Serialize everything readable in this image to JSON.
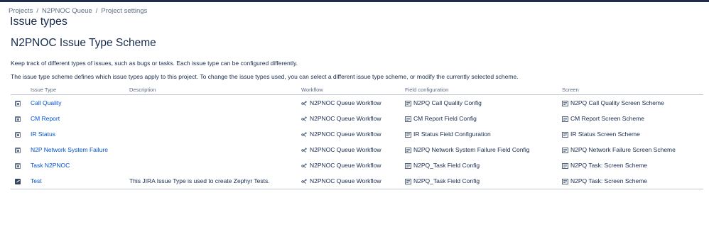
{
  "breadcrumb": [
    "Projects",
    "N2PNOC Queue",
    "Project settings"
  ],
  "page_title": "Issue types",
  "scheme_title": "N2PNOC Issue Type Scheme",
  "description_1": "Keep track of different types of issues, such as bugs or tasks. Each issue type can be configured differently.",
  "description_2": "The issue type scheme defines which issue types apply to this project. To change the issue types used, you can select a different issue type scheme, or modify the currently selected scheme.",
  "columns": {
    "issue_type": "Issue Type",
    "description": "Description",
    "workflow": "Workflow",
    "field_configuration": "Field configuration",
    "screen": "Screen"
  },
  "rows": [
    {
      "icon": "issue-type-icon",
      "name": "Call Quality",
      "description": "",
      "workflow": "N2PNOC Queue Workflow",
      "field_config": "N2PQ Call Quality Config",
      "screen": "N2PQ Call Quality Screen Scheme"
    },
    {
      "icon": "issue-type-icon",
      "name": "CM Report",
      "description": "",
      "workflow": "N2PNOC Queue Workflow",
      "field_config": "CM Report Field Config",
      "screen": "CM Report Screen Scheme"
    },
    {
      "icon": "issue-type-icon",
      "name": "IR Status",
      "description": "",
      "workflow": "N2PNOC Queue Workflow",
      "field_config": "IR Status Field Configuration",
      "screen": "IR Status Screen Scheme"
    },
    {
      "icon": "issue-type-icon",
      "name": "N2P Network System Failure",
      "description": "",
      "workflow": "N2PNOC Queue Workflow",
      "field_config": "N2PQ Network System Failure Field Config",
      "screen": "N2PQ Network Failure Screen Scheme"
    },
    {
      "icon": "issue-type-icon",
      "name": "Task N2PNOC",
      "description": "",
      "workflow": "N2PNOC Queue Workflow",
      "field_config": "N2PQ_Task Field Config",
      "screen": "N2PQ Task: Screen Scheme"
    },
    {
      "icon": "test-issue-icon",
      "name": "Test",
      "description": "This JIRA Issue Type is used to create Zephyr Tests.",
      "workflow": "N2PNOC Queue Workflow",
      "field_config": "N2PQ_Task Field Config",
      "screen": "N2PQ Task: Screen Scheme"
    }
  ],
  "colors": {
    "link": "#0052cc",
    "text": "#172b4d",
    "muted": "#5e6c84",
    "topbar": "#1f2d4a"
  }
}
